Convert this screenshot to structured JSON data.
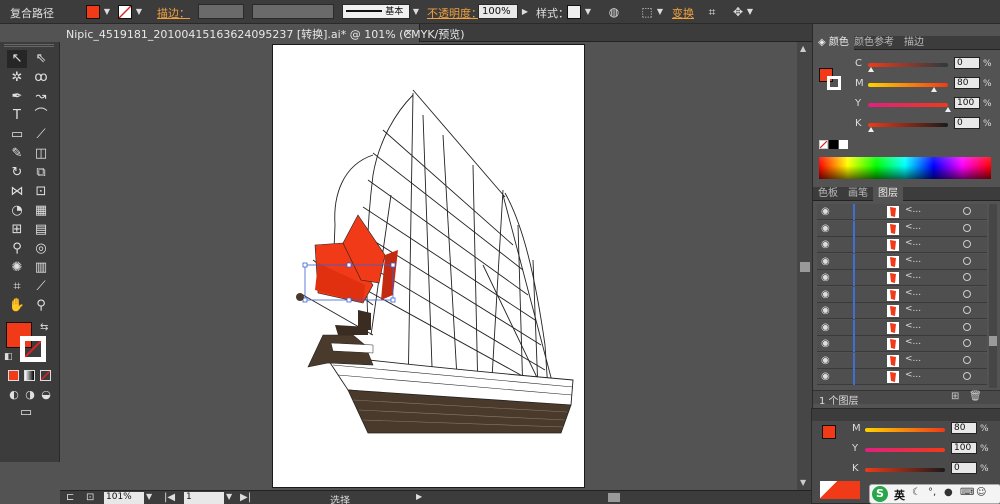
{
  "control_bar": {
    "selection_type": "复合路径",
    "stroke_label": "描边：",
    "stroke_profile": "基本",
    "opacity_label": "不透明度：",
    "opacity_value": "100%",
    "style_label": "样式：",
    "transform_label": "变换",
    "fill_color": "#f03a18"
  },
  "document_tab": {
    "title": "Nipic_4519181_20100415163624095237 [转换].ai* @ 101% (CMYK/预览)",
    "close": "×"
  },
  "tools": {
    "fill_color": "#f03a18"
  },
  "status_bar": {
    "zoom": "101%",
    "artboard_number": "1",
    "tool_name": "选择"
  },
  "color_panel": {
    "tabs": [
      "颜色",
      "颜色参考",
      "描边"
    ],
    "channels": [
      {
        "label": "C",
        "value": "0",
        "unit": "%"
      },
      {
        "label": "M",
        "value": "80",
        "unit": "%"
      },
      {
        "label": "Y",
        "value": "100",
        "unit": "%"
      },
      {
        "label": "K",
        "value": "0",
        "unit": "%"
      }
    ]
  },
  "layers_panel": {
    "tabs": [
      "色板",
      "画笔",
      "图层"
    ],
    "row_name": "<...",
    "row_count": 11,
    "footer": "1 个图层"
  },
  "floating_color_panel": {
    "channels": [
      {
        "label": "M",
        "value": "80",
        "unit": "%"
      },
      {
        "label": "Y",
        "value": "100",
        "unit": "%"
      },
      {
        "label": "K",
        "value": "0",
        "unit": "%"
      }
    ]
  },
  "taskbar": {
    "ime_label": "英",
    "ime_logo": "S"
  }
}
